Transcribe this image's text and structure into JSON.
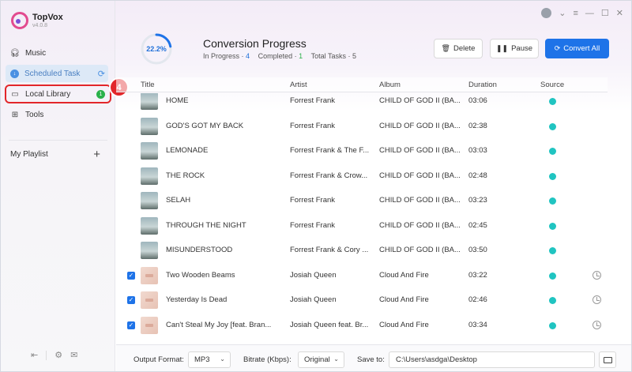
{
  "app": {
    "name": "TopVox",
    "version": "v4.0.8"
  },
  "sidebar": {
    "items": [
      {
        "label": "Music",
        "icon": "headphones-icon"
      },
      {
        "label": "Scheduled Task",
        "icon": "download-icon"
      },
      {
        "label": "Local Library",
        "icon": "library-icon",
        "badge": "1"
      },
      {
        "label": "Tools",
        "icon": "grid-icon"
      }
    ],
    "playlist_label": "My Playlist"
  },
  "annotation": {
    "step": "4"
  },
  "header": {
    "progress": "22.2%",
    "progress_value": 0.222,
    "title": "Conversion Progress",
    "in_progress_label": "In Progress ·",
    "in_progress_count": "4",
    "completed_label": "Completed ·",
    "completed_count": "1",
    "total_label": "Total Tasks ·",
    "total_count": "5",
    "delete_label": "Delete",
    "pause_label": "Pause",
    "convert_label": "Convert All"
  },
  "table": {
    "columns": [
      "Title",
      "Artist",
      "Album",
      "Duration",
      "Source"
    ],
    "rows": [
      {
        "title": "HOME",
        "artist": "Forrest Frank",
        "album": "CHILD OF GOD II (BA...",
        "duration": "03:06",
        "checked": false,
        "thumb": "dark"
      },
      {
        "title": "GOD'S GOT MY BACK",
        "artist": "Forrest Frank",
        "album": "CHILD OF GOD II (BA...",
        "duration": "02:38",
        "checked": false,
        "thumb": "dark"
      },
      {
        "title": "LEMONADE",
        "artist": "Forrest Frank & The F...",
        "album": "CHILD OF GOD II (BA...",
        "duration": "03:03",
        "checked": false,
        "thumb": "dark"
      },
      {
        "title": "THE ROCK",
        "artist": "Forrest Frank & Crow...",
        "album": "CHILD OF GOD II (BA...",
        "duration": "02:48",
        "checked": false,
        "thumb": "dark"
      },
      {
        "title": "SELAH",
        "artist": "Forrest Frank",
        "album": "CHILD OF GOD II (BA...",
        "duration": "03:23",
        "checked": false,
        "thumb": "dark"
      },
      {
        "title": "THROUGH THE NIGHT",
        "artist": "Forrest Frank",
        "album": "CHILD OF GOD II (BA...",
        "duration": "02:45",
        "checked": false,
        "thumb": "dark"
      },
      {
        "title": "MISUNDERSTOOD",
        "artist": "Forrest Frank & Cory ...",
        "album": "CHILD OF GOD II (BA...",
        "duration": "03:50",
        "checked": false,
        "thumb": "dark"
      },
      {
        "title": "Two Wooden Beams",
        "artist": "Josiah Queen",
        "album": "Cloud And Fire",
        "duration": "03:22",
        "checked": true,
        "thumb": "light"
      },
      {
        "title": "Yesterday Is Dead",
        "artist": "Josiah Queen",
        "album": "Cloud And Fire",
        "duration": "02:46",
        "checked": true,
        "thumb": "light"
      },
      {
        "title": "Can't Steal My Joy [feat. Bran...",
        "artist": "Josiah Queen feat. Br...",
        "album": "Cloud And Fire",
        "duration": "03:34",
        "checked": true,
        "thumb": "light"
      }
    ]
  },
  "footer": {
    "format_label": "Output Format:",
    "format_value": "MP3",
    "bitrate_label": "Bitrate (Kbps):",
    "bitrate_value": "Original",
    "save_label": "Save to:",
    "save_path": "C:\\Users\\asdga\\Desktop"
  },
  "colors": {
    "accent": "#1e73e8",
    "highlight": "#e2262a",
    "source": "#20c4c1",
    "badge": "#2bb14a"
  }
}
